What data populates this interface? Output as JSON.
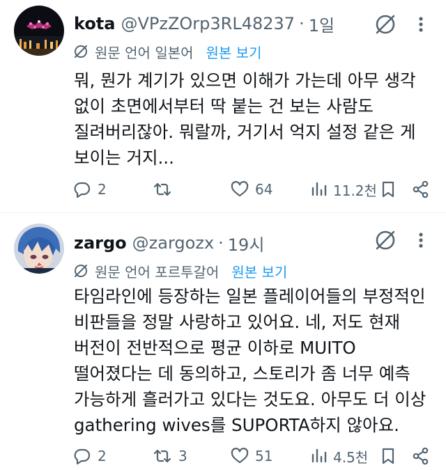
{
  "tweets": [
    {
      "name": "kota",
      "handle": "@VPzZOrp3RL48237",
      "separator": "·",
      "time": "1일",
      "translation_note": "원문 언어 일본어",
      "show_original": "원본 보기",
      "lines": [
        "뭐, 뭔가 계기가 있으면 이해가 가는데 아무 생각",
        "없이 초면에서부터 딱 붙는 건 보는 사람도",
        "질려버리잖아. 뭐랄까, 거기서 억지 설정 같은 게",
        "보이는 거지..."
      ],
      "replies": "2",
      "reposts": "",
      "likes": "64",
      "views": "11.2천",
      "avatar_icon": "night-city-lights"
    },
    {
      "name": "zargo",
      "handle": "@zargozx",
      "separator": "·",
      "time": "19시",
      "translation_note": "원문 언어 포르투갈어",
      "show_original": "원본 보기",
      "lines": [
        "타임라인에 등장하는 일본 플레이어들의 부정적인",
        "비판들을 정말 사랑하고 있어요. 네, 저도 현재",
        "버전이 전반적으로 평균 이하로 MUITO",
        "떨어졌다는 데 동의하고, 스토리가 좀 너무 예측",
        "가능하게 흘러가고 있다는 것도요. 아무도 더 이상",
        "gathering wives를 SUPORTA하지 않아요."
      ],
      "replies": "2",
      "reposts": "3",
      "likes": "51",
      "views": "4.5천",
      "avatar_icon": "anime-character-blue-hair"
    }
  ],
  "colors": {
    "text": "#0f1419",
    "secondary": "#536471",
    "link": "#1d9bf0",
    "divider": "#eff3f4"
  }
}
